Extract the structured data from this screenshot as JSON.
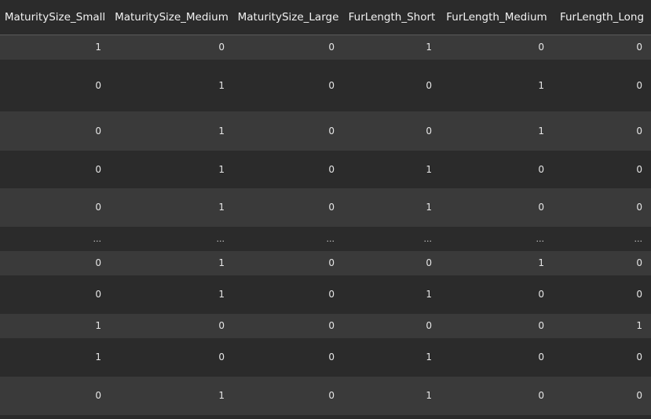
{
  "table": {
    "columns": [
      "MaturitySize_Small",
      "MaturitySize_Medium",
      "MaturitySize_Large",
      "FurLength_Short",
      "FurLength_Medium",
      "FurLength_Long"
    ],
    "rows": [
      [
        "1",
        "0",
        "0",
        "1",
        "0",
        "0"
      ],
      [
        "0",
        "1",
        "0",
        "0",
        "1",
        "0"
      ],
      [
        "0",
        "1",
        "0",
        "0",
        "1",
        "0"
      ],
      [
        "0",
        "1",
        "0",
        "1",
        "0",
        "0"
      ],
      [
        "0",
        "1",
        "0",
        "1",
        "0",
        "0"
      ],
      [
        "...",
        "...",
        "...",
        "...",
        "...",
        "..."
      ],
      [
        "0",
        "1",
        "0",
        "0",
        "1",
        "0"
      ],
      [
        "0",
        "1",
        "0",
        "1",
        "0",
        "0"
      ],
      [
        "1",
        "0",
        "0",
        "0",
        "0",
        "1"
      ],
      [
        "1",
        "0",
        "0",
        "1",
        "0",
        "0"
      ],
      [
        "0",
        "1",
        "0",
        "1",
        "0",
        "0"
      ]
    ]
  }
}
